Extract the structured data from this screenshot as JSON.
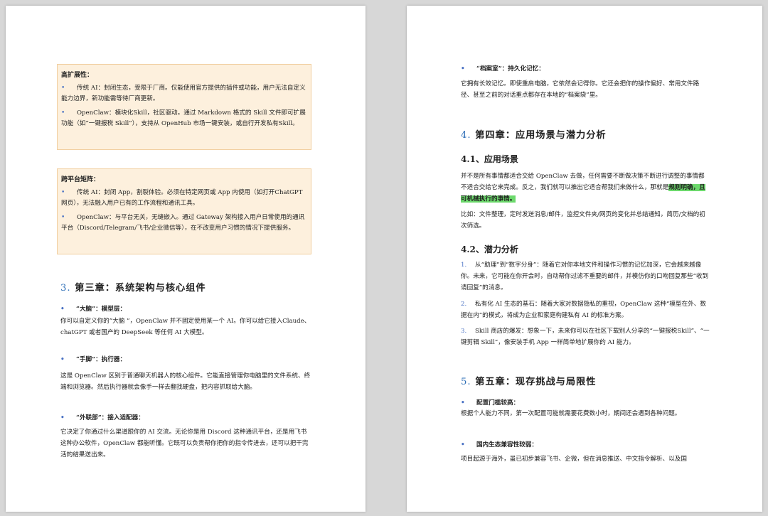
{
  "left_page": {
    "box1": {
      "title": "高扩展性：",
      "bullet1": "传统 AI：封闭生态，受限于厂商。仅能使用官方提供的插件或功能，用户无法自定义能力边界，新功能需等待厂商更新。",
      "bullet2": "OpenClaw：模块化Skill，社区驱动。通过 Markdown 格式的 Skill 文件即可扩展功能（如“一键报税 Skill”），支持从 OpenHub 市场一键安装，或自行开发私有Skill。"
    },
    "box2": {
      "title": "跨平台矩阵：",
      "bullet1": "传统 AI：封闭 App，割裂体验。必须在特定网页或 App 内使用（如打开ChatGPT 网页），无法融入用户已有的工作流程和通讯工具。",
      "bullet2": "OpenClaw：与平台无关，无缝嵌入。通过 Gateway 架构接入用户日常使用的通讯平台（Discord/Telegram/飞书/企业微信等），在不改变用户习惯的情况下提供服务。"
    },
    "chapter3": {
      "num": "3.",
      "title": "第三章：系统架构与核心组件"
    },
    "item1": {
      "head": "“大脑”：模型层：",
      "text": "你可以自定义你的”大脑 ”，OpenClaw 并不固定使用某一个 AI。你可以给它接入Claude、chatGPT 或者国产的 DeepSeek 等任何 AI 大模型。"
    },
    "item2": {
      "head": "“手脚”：执行器：",
      "text": "这是 OpenClaw 区别于普通聊天机器人的核心组件。它能直接管理你电脑里的文件系统、终端和浏览器。然后执行器就会像手一样去翻找硬盘，把内容抓取给大脑。"
    },
    "item3": {
      "head": "“外联部”：接入适配器：",
      "text": "它决定了你通过什么渠道跟你的 AI 交流。无论你是用 Discord 这种通讯平台，还是用飞书这种办公软件，OpenClaw 都能听懂。它既可以负责帮你把你的指令传进去，还可以把干完活的结果送出来。"
    }
  },
  "right_page": {
    "item4": {
      "head": "“档案室”：持久化记忆：",
      "text": "它拥有长效记忆。即使重启电脑，它依然会记得你。它还会把你的操作偏好、常用文件路径、甚至之前的对话重点都存在本地的“档案袋”里。"
    },
    "chapter4": {
      "num": "4.",
      "title": "第四章：应用场景与潜力分析"
    },
    "sec41": "4.1、应用场景",
    "p41a_pre": "并不是所有事情都适合交给 OpenClaw 去做，任何需要不断做决策不断进行调整的事情都不适合交给它来完成。反之，我们就可以推出它适合帮我们来做什么，那就是",
    "p41a_hl": "规则明确，且可机械执行的事情。",
    "p41b": "比如：文件整理，定时发送消息/邮件，监控文件夹/网页的变化并总结通知，简历/文档的初次筛选。",
    "sec42": "4.2、潜力分析",
    "ol": [
      {
        "n": "1.",
        "text": "从“助理”到“数字分身”：随着它对你本地文件和操作习惯的记忆加深，它会越来越像你。未来，它可能在你开会时，自动帮你过滤不重要的邮件，并模仿你的口吻回复那些“收到请回复”的消息。"
      },
      {
        "n": "2.",
        "text": "私有化 AI 生态的基石：随着大家对数据隐私的重视，OpenClaw 这种“模型在外、数据在内”的模式，将成为企业和家庭构建私有 AI 的标准方案。"
      },
      {
        "n": "3.",
        "text": "Skill 商店的爆发：想象一下，未来你可以在社区下载别人分享的“一键报税Skill”、“一键剪辑 Skill”，像安装手机 App 一样简单地扩展你的 AI 能力。"
      }
    ],
    "chapter5": {
      "num": "5.",
      "title": "第五章：现存挑战与局限性"
    },
    "c1": {
      "head": "配置门槛较高：",
      "text": "根据个人能力不同，第一次配置可能就需要花费数小时，期间还会遇到各种问题。"
    },
    "c2": {
      "head": "国内生态兼容性较弱：",
      "text": "项目起源于海外，虽已初步兼容飞书、企微，但在消息推送、中文指令解析、以及国"
    }
  }
}
